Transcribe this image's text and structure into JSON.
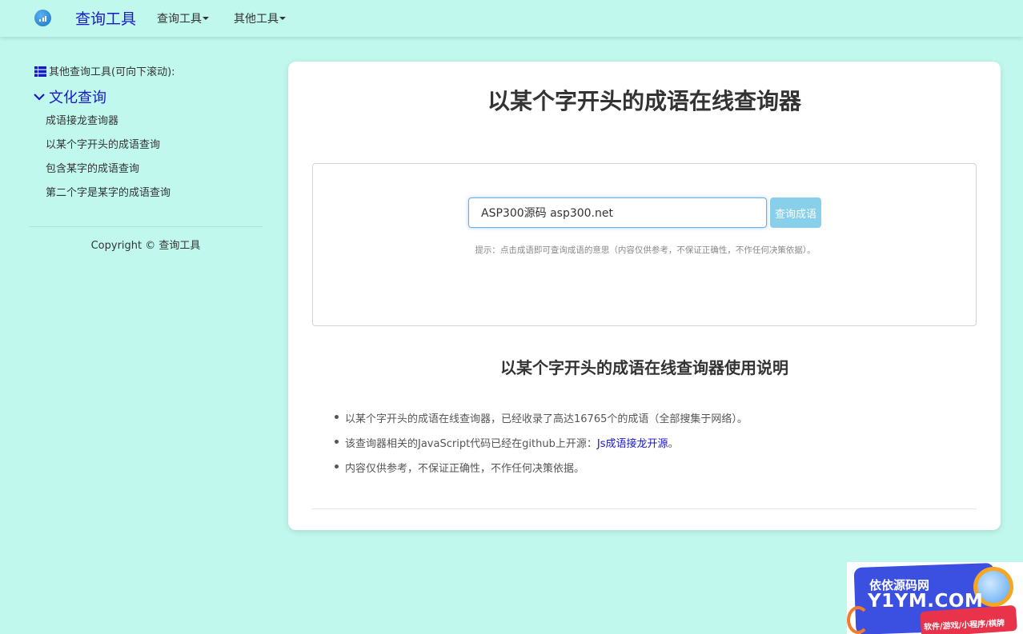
{
  "navbar": {
    "brand": "查询工具",
    "menu": [
      "查询工具",
      "其他工具"
    ]
  },
  "sidebar": {
    "heading": "其他查询工具(可向下滚动):",
    "category": "文化查询",
    "links": [
      "成语接龙查询器",
      "以某个字开头的成语查询",
      "包含某字的成语查询",
      "第二个字是某字的成语查询"
    ],
    "copyright": "Copyright © 查询工具"
  },
  "main": {
    "title": "以某个字开头的成语在线查询器",
    "search": {
      "value": "ASP300源码 asp300.net",
      "button": "查询成语",
      "hint": "提示：点击成语即可查询成语的意思（内容仅供参考，不保证正确性，不作任何决策依据）。"
    },
    "usage_title": "以某个字开头的成语在线查询器使用说明",
    "usage": {
      "item1": "以某个字开头的成语在线查询器，已经收录了高达16765个的成语（全部搜集于网络）。",
      "item2_prefix": "该查询器相关的JavaScript代码已经在github上开源：",
      "item2_link": "Js成语接龙开源",
      "item2_suffix": "。",
      "item3": "内容仅供参考，不保证正确性，不作任何决策依据。"
    }
  },
  "ad": {
    "title": "依依源码网",
    "domain": "Y1YM.COM",
    "tagline": "软件/游戏/小程序/棋牌"
  },
  "colors": {
    "background": "#c0f8ee",
    "brand": "#1a18c8",
    "button": "#88cfea"
  }
}
